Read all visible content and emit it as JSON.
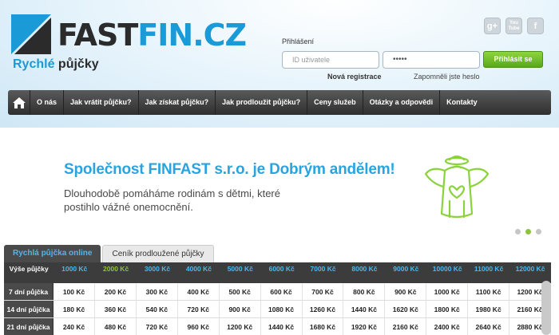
{
  "brand": {
    "logo_part1": "FAST",
    "logo_part2": "FIN.CZ",
    "tagline_part1": "Rychlé",
    "tagline_part2": "půjčky",
    "accent": "#1a9ad6"
  },
  "social": [
    "g+",
    "You Tube",
    "f"
  ],
  "login": {
    "label": "Přihlášení",
    "user_placeholder": "ID uživatele",
    "password_value": "•••••",
    "button": "Přihlásit se",
    "register": "Nová registrace",
    "forgot": "Zapomněli jste heslo"
  },
  "nav": {
    "items": [
      "O nás",
      "Jak vrátit půjčku?",
      "Jak získat půjčku?",
      "Jak prodloužit půjčku?",
      "Ceny služeb",
      "Otázky a odpovědi",
      "Kontakty"
    ]
  },
  "hero": {
    "title": "Společnost FINFAST s.r.o. je Dobrým andělem!",
    "subtitle": "Dlouhodobě pomáháme rodinám s dětmi, které postihlo vážné onemocnění."
  },
  "tabs": [
    "Rychlá půjčka online",
    "Ceník prodloužené půjčky"
  ],
  "table": {
    "corner": "Výše půjčky",
    "columns": [
      "1000 Kč",
      "2000 Kč",
      "3000 Kč",
      "4000 Kč",
      "5000 Kč",
      "6000 Kč",
      "7000 Kč",
      "8000 Kč",
      "9000 Kč",
      "10000 Kč",
      "11000 Kč",
      "12000 Kč"
    ],
    "highlight_index": 1,
    "rows": [
      {
        "label": "7 dní půjčka",
        "values": [
          "100 Kč",
          "200 Kč",
          "300 Kč",
          "400 Kč",
          "500 Kč",
          "600 Kč",
          "700 Kč",
          "800 Kč",
          "900 Kč",
          "1000 Kč",
          "1100 Kč",
          "1200 Kč"
        ]
      },
      {
        "label": "14 dní půjčka",
        "values": [
          "180 Kč",
          "360 Kč",
          "540 Kč",
          "720 Kč",
          "900 Kč",
          "1080 Kč",
          "1260 Kč",
          "1440 Kč",
          "1620 Kč",
          "1800 Kč",
          "1980 Kč",
          "2160 Kč"
        ]
      },
      {
        "label": "21 dní půjčka",
        "values": [
          "240 Kč",
          "480 Kč",
          "720 Kč",
          "960 Kč",
          "1200 Kč",
          "1440 Kč",
          "1680 Kč",
          "1920 Kč",
          "2160 Kč",
          "2400 Kč",
          "2640 Kč",
          "2880 Kč"
        ]
      }
    ]
  }
}
